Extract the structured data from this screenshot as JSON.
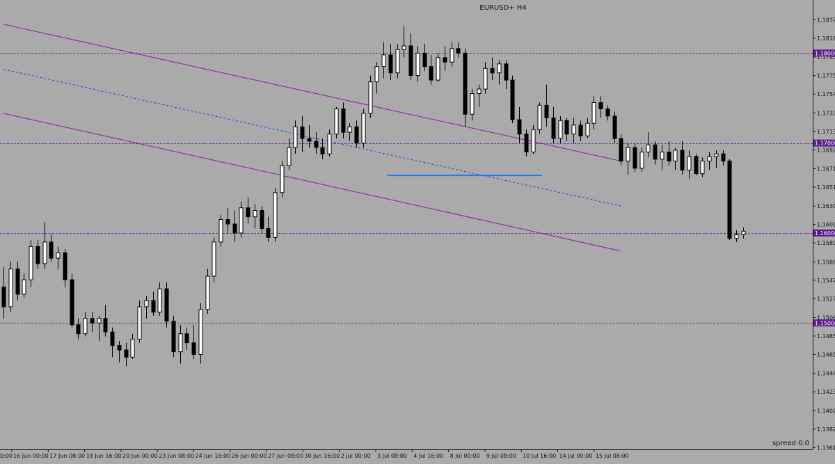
{
  "chart_data": {
    "type": "candlestick",
    "title": "EURUSD+ H4",
    "spread_label": "spread 0.0",
    "ylim": [
      1.1361,
      1.1842
    ],
    "y_ticks": [
      "1.18370",
      "1.18165",
      "1.17955",
      "1.17750",
      "1.17545",
      "1.17335",
      "1.17130",
      "1.16925",
      "1.16715",
      "1.16510",
      "1.16300",
      "1.16095",
      "1.15890",
      "1.15680",
      "1.15475",
      "1.15270",
      "1.15060",
      "1.14855",
      "1.14650",
      "1.14440",
      "1.14235",
      "1.14025",
      "1.13820",
      "1.13615"
    ],
    "x_ticks": [
      "16 Jun 00:00",
      "17 Jun 08:00",
      "18 Jun 16:00",
      "20 Jun 00:00",
      "23 Jun 08:00",
      "24 Jun 16:00",
      "26 Jun 00:00",
      "27 Jun 08:00",
      "30 Jun 16:00",
      "2 Jul 00:00",
      "3 Jul 08:00",
      "4 Jul 16:00",
      "8 Jul 00:00",
      "9 Jul 08:00",
      "10 Jul 16:00",
      "14 Jul 00:00",
      "15 Jul 08:00"
    ],
    "x_tick_partial": "0:00",
    "levels": [
      {
        "label": "1.18000",
        "value": 1.18
      },
      {
        "label": "1.17000",
        "value": 1.17
      },
      {
        "label": "1.16000",
        "value": 1.16
      },
      {
        "label": "1.15000",
        "value": 1.15
      }
    ],
    "channel": {
      "upper": [
        [
          0,
          1.1832
        ],
        [
          91,
          1.168
        ]
      ],
      "lower": [
        [
          0,
          1.1733
        ],
        [
          91,
          1.158
        ]
      ],
      "mid": [
        [
          0,
          1.1782
        ],
        [
          91,
          1.163
        ]
      ]
    },
    "support": {
      "from": 57,
      "to": 79,
      "value": 1.1664
    },
    "candles": [
      [
        1.154,
        1.1562,
        1.1505,
        1.1518
      ],
      [
        1.1518,
        1.1568,
        1.1512,
        1.156
      ],
      [
        1.156,
        1.1568,
        1.1525,
        1.1532
      ],
      [
        1.1532,
        1.1555,
        1.1528,
        1.1548
      ],
      [
        1.1548,
        1.1592,
        1.154,
        1.1585
      ],
      [
        1.1585,
        1.1592,
        1.156,
        1.1566
      ],
      [
        1.1566,
        1.1612,
        1.156,
        1.159
      ],
      [
        1.159,
        1.1598,
        1.1568,
        1.1572
      ],
      [
        1.1572,
        1.1585,
        1.156,
        1.1578
      ],
      [
        1.1578,
        1.1582,
        1.154,
        1.1548
      ],
      [
        1.1548,
        1.1555,
        1.1495,
        1.1498
      ],
      [
        1.1498,
        1.1505,
        1.1482,
        1.1488
      ],
      [
        1.1488,
        1.1512,
        1.1485,
        1.1505
      ],
      [
        1.1505,
        1.1512,
        1.149,
        1.15
      ],
      [
        1.15,
        1.1508,
        1.148,
        1.1505
      ],
      [
        1.1505,
        1.152,
        1.1485,
        1.149
      ],
      [
        1.149,
        1.1495,
        1.1462,
        1.1475
      ],
      [
        1.1475,
        1.148,
        1.1456,
        1.147
      ],
      [
        1.147,
        1.1478,
        1.1452,
        1.1462
      ],
      [
        1.1462,
        1.1488,
        1.146,
        1.1482
      ],
      [
        1.1482,
        1.1525,
        1.1478,
        1.1518
      ],
      [
        1.1518,
        1.153,
        1.1505,
        1.1525
      ],
      [
        1.1525,
        1.1535,
        1.1508,
        1.1512
      ],
      [
        1.1512,
        1.1545,
        1.1508,
        1.1538
      ],
      [
        1.1538,
        1.1545,
        1.1495,
        1.1502
      ],
      [
        1.1502,
        1.1508,
        1.1462,
        1.1468
      ],
      [
        1.1468,
        1.1498,
        1.1455,
        1.1488
      ],
      [
        1.1488,
        1.1495,
        1.147,
        1.1478
      ],
      [
        1.1478,
        1.1498,
        1.146,
        1.1465
      ],
      [
        1.1465,
        1.1522,
        1.1455,
        1.1515
      ],
      [
        1.1515,
        1.156,
        1.151,
        1.1552
      ],
      [
        1.1552,
        1.1595,
        1.1545,
        1.159
      ],
      [
        1.159,
        1.162,
        1.1585,
        1.1615
      ],
      [
        1.1615,
        1.1628,
        1.16,
        1.161
      ],
      [
        1.161,
        1.1625,
        1.159,
        1.16
      ],
      [
        1.16,
        1.1635,
        1.1595,
        1.1628
      ],
      [
        1.1628,
        1.164,
        1.161,
        1.1618
      ],
      [
        1.1618,
        1.1632,
        1.1605,
        1.1625
      ],
      [
        1.1625,
        1.163,
        1.16,
        1.1605
      ],
      [
        1.1605,
        1.1618,
        1.159,
        1.1595
      ],
      [
        1.1595,
        1.165,
        1.159,
        1.1645
      ],
      [
        1.1645,
        1.168,
        1.164,
        1.1675
      ],
      [
        1.1675,
        1.1705,
        1.167,
        1.1695
      ],
      [
        1.1695,
        1.1725,
        1.1688,
        1.1718
      ],
      [
        1.1718,
        1.173,
        1.169,
        1.1705
      ],
      [
        1.1705,
        1.172,
        1.1695,
        1.1702
      ],
      [
        1.1702,
        1.1712,
        1.1688,
        1.1695
      ],
      [
        1.1695,
        1.1705,
        1.1682,
        1.1688
      ],
      [
        1.1688,
        1.1715,
        1.1685,
        1.171
      ],
      [
        1.171,
        1.174,
        1.1705,
        1.1738
      ],
      [
        1.1738,
        1.1745,
        1.1705,
        1.1712
      ],
      [
        1.1712,
        1.1722,
        1.1702,
        1.1718
      ],
      [
        1.1718,
        1.1725,
        1.1695,
        1.17
      ],
      [
        1.17,
        1.1738,
        1.1695,
        1.1733
      ],
      [
        1.1733,
        1.1775,
        1.1728,
        1.1768
      ],
      [
        1.1768,
        1.179,
        1.1755,
        1.1785
      ],
      [
        1.1785,
        1.1812,
        1.1772,
        1.1798
      ],
      [
        1.1798,
        1.181,
        1.177,
        1.1778
      ],
      [
        1.1778,
        1.181,
        1.1772,
        1.1804
      ],
      [
        1.1804,
        1.183,
        1.1795,
        1.1808
      ],
      [
        1.1808,
        1.1822,
        1.177,
        1.1775
      ],
      [
        1.1775,
        1.1808,
        1.1768,
        1.18
      ],
      [
        1.18,
        1.181,
        1.178,
        1.1785
      ],
      [
        1.1785,
        1.1798,
        1.1765,
        1.177
      ],
      [
        1.177,
        1.18,
        1.1768,
        1.1795
      ],
      [
        1.1795,
        1.1808,
        1.178,
        1.179
      ],
      [
        1.179,
        1.1812,
        1.1785,
        1.1805
      ],
      [
        1.1805,
        1.1812,
        1.1795,
        1.18
      ],
      [
        1.18,
        1.1805,
        1.1718,
        1.1732
      ],
      [
        1.1732,
        1.176,
        1.1725,
        1.1755
      ],
      [
        1.1755,
        1.1765,
        1.174,
        1.176
      ],
      [
        1.176,
        1.179,
        1.1755,
        1.1783
      ],
      [
        1.1783,
        1.1795,
        1.177,
        1.1778
      ],
      [
        1.1778,
        1.1792,
        1.1765,
        1.1788
      ],
      [
        1.1788,
        1.1792,
        1.176,
        1.177
      ],
      [
        1.177,
        1.1775,
        1.1722,
        1.1726
      ],
      [
        1.1726,
        1.174,
        1.17,
        1.171
      ],
      [
        1.171,
        1.1715,
        1.1685,
        1.169
      ],
      [
        1.169,
        1.172,
        1.1688,
        1.1715
      ],
      [
        1.1715,
        1.1745,
        1.171,
        1.1742
      ],
      [
        1.1742,
        1.1765,
        1.1718,
        1.1728
      ],
      [
        1.1728,
        1.174,
        1.17,
        1.1705
      ],
      [
        1.1705,
        1.173,
        1.17,
        1.1725
      ],
      [
        1.1725,
        1.1728,
        1.1702,
        1.171
      ],
      [
        1.171,
        1.1728,
        1.17,
        1.172
      ],
      [
        1.172,
        1.1725,
        1.1702,
        1.1708
      ],
      [
        1.1708,
        1.1728,
        1.1705,
        1.1722
      ],
      [
        1.1722,
        1.1752,
        1.1715,
        1.1745
      ],
      [
        1.1745,
        1.1752,
        1.1728,
        1.1738
      ],
      [
        1.1738,
        1.1742,
        1.1725,
        1.173
      ],
      [
        1.173,
        1.1735,
        1.17,
        1.1705
      ],
      [
        1.1705,
        1.171,
        1.1675,
        1.168
      ],
      [
        1.168,
        1.17,
        1.1665,
        1.1695
      ],
      [
        1.1695,
        1.17,
        1.1668,
        1.1672
      ],
      [
        1.1672,
        1.1695,
        1.1668,
        1.169
      ],
      [
        1.169,
        1.1712,
        1.1684,
        1.1698
      ],
      [
        1.1698,
        1.1702,
        1.1676,
        1.1682
      ],
      [
        1.1682,
        1.1698,
        1.167,
        1.169
      ],
      [
        1.169,
        1.1702,
        1.1675,
        1.168
      ],
      [
        1.168,
        1.1695,
        1.167,
        1.1692
      ],
      [
        1.1692,
        1.1702,
        1.1665,
        1.167
      ],
      [
        1.167,
        1.1692,
        1.166,
        1.1685
      ],
      [
        1.1685,
        1.1688,
        1.1664,
        1.1666
      ],
      [
        1.1666,
        1.1684,
        1.1662,
        1.168
      ],
      [
        1.168,
        1.169,
        1.167,
        1.1685
      ],
      [
        1.1685,
        1.1692,
        1.1672,
        1.1688
      ],
      [
        1.1688,
        1.1692,
        1.1675,
        1.168
      ],
      [
        1.168,
        1.1682,
        1.1592,
        1.1594
      ],
      [
        1.1594,
        1.1603,
        1.159,
        1.1598
      ],
      [
        1.1598,
        1.1606,
        1.1594,
        1.1602
      ]
    ]
  }
}
